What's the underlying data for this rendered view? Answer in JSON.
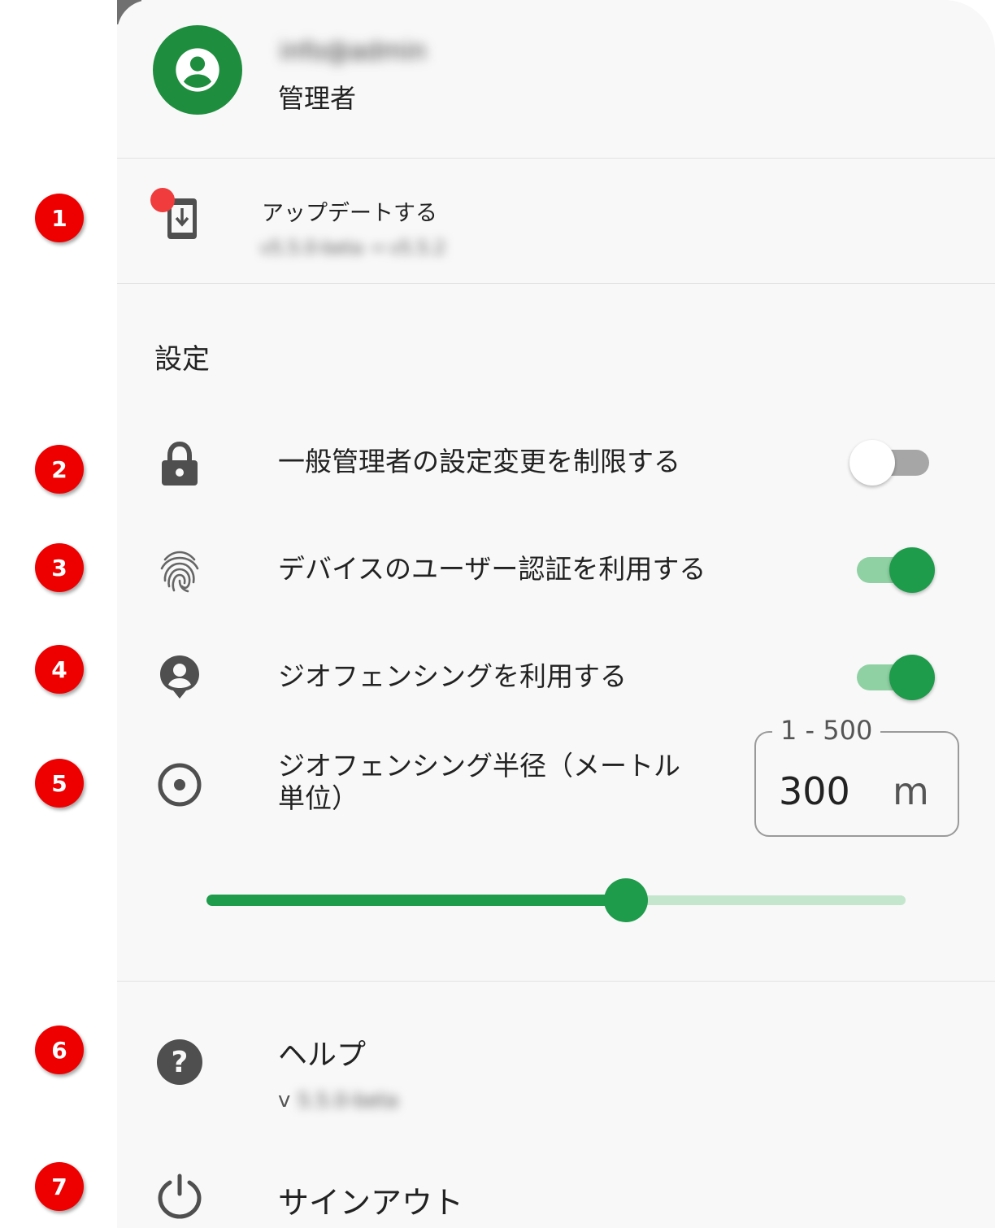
{
  "header": {
    "user_name": "info@admin",
    "user_role": "管理者"
  },
  "update": {
    "title": "アップデートする",
    "version_change": "v5.5.0-beta → v5.5.2"
  },
  "settings": {
    "section_title": "設定",
    "restrict_admin": {
      "label": "一般管理者の設定変更を制限する",
      "enabled": false
    },
    "device_auth": {
      "label": "デバイスのユーザー認証を利用する",
      "enabled": true
    },
    "geofencing": {
      "label": "ジオフェンシングを利用する",
      "enabled": true
    },
    "geofence_radius": {
      "label_line1": "ジオフェンシング半径（メートル",
      "label_line2": "単位）",
      "range_label": "1 - 500",
      "value": "300",
      "unit": "m",
      "min": 1,
      "max": 500,
      "slider_value": 300
    }
  },
  "help": {
    "title": "ヘルプ",
    "version_prefix": "v",
    "version_value": "5.5.0-beta"
  },
  "signout": {
    "label": "サインアウト"
  },
  "markers": [
    "1",
    "2",
    "3",
    "4",
    "5",
    "6",
    "7"
  ],
  "colors": {
    "accent": "#1e9b4b",
    "avatar_bg": "#1e8e3e",
    "marker": "#ee0000",
    "notification_dot": "#f03c3c"
  },
  "icons": {
    "avatar": "account-circle-icon",
    "update": "system-update-icon",
    "lock": "lock-icon",
    "fingerprint": "fingerprint-icon",
    "geofence": "person-pin-icon",
    "radius": "radio-target-icon",
    "help": "help-icon",
    "signout": "power-icon"
  }
}
